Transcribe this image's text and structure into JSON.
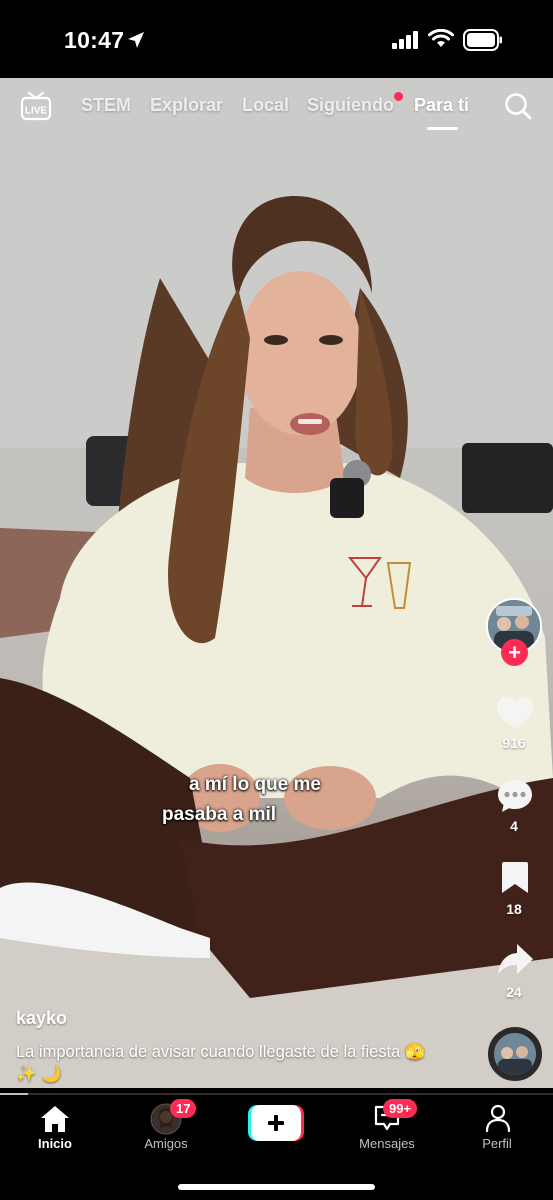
{
  "status_bar": {
    "time": "10:47"
  },
  "top_nav": {
    "live_icon_label": "LIVE",
    "tabs": [
      {
        "label": "STEM"
      },
      {
        "label": "Explorar"
      },
      {
        "label": "Local"
      },
      {
        "label": "Siguiendo"
      },
      {
        "label": "Para ti"
      }
    ],
    "active_tab": "Para ti"
  },
  "video": {
    "captions": [
      "a mí lo que me",
      "pasaba a mil"
    ]
  },
  "right_rail": {
    "likes": "916",
    "comments": "4",
    "saves": "18",
    "shares": "24"
  },
  "post": {
    "username": "kayko",
    "description": "La importancia de avisar cuando llegaste de la fiesta 🫣 ✨ 🌙",
    "progress": 0.05
  },
  "bottom_nav": {
    "items": [
      {
        "label": "Inicio",
        "icon": "home-icon"
      },
      {
        "label": "Amigos",
        "icon": "friends-avatar",
        "badge": "17"
      },
      {
        "label": "",
        "icon": "create-plus-icon"
      },
      {
        "label": "Mensajes",
        "icon": "inbox-icon",
        "badge": "99+"
      },
      {
        "label": "Perfil",
        "icon": "profile-icon"
      }
    ]
  },
  "colors": {
    "accent": "#fe2c55",
    "accent_cyan": "#25f4ee"
  }
}
